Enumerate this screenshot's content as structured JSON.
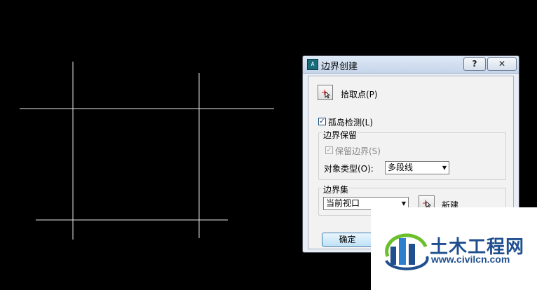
{
  "dialog": {
    "title": "边界创建",
    "help_label": "?",
    "close_label": "✕",
    "pick_points_label": "拾取点(P)",
    "island_detection_label": "孤岛检测(L)",
    "island_detection_checked": true,
    "boundary_retention": {
      "title": "边界保留",
      "retain_label": "保留边界(S)",
      "retain_checked": true,
      "object_type_label": "对象类型(O):",
      "object_type_value": "多段线"
    },
    "boundary_set": {
      "title": "边界集",
      "value": "当前视口",
      "new_label": "新建"
    },
    "ok_label": "确定"
  },
  "watermark": {
    "brand": "土木工程网",
    "url": "www.civilcn.com"
  },
  "colors": {
    "background": "#000000",
    "cad_lines": "#e8e8e8",
    "brand_blue": "#1f4f8f",
    "brand_green": "#6abf2a"
  }
}
